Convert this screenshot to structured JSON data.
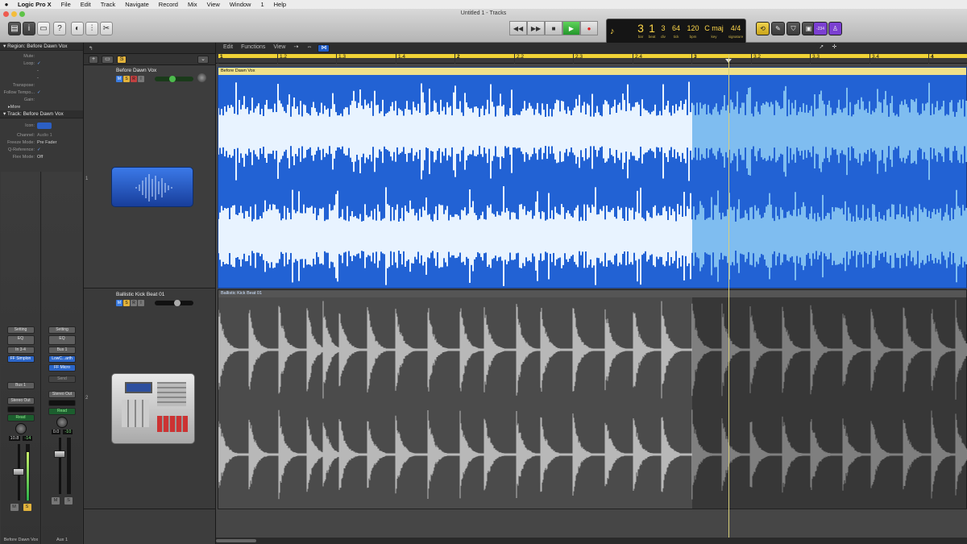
{
  "menubar": {
    "apple": "",
    "app": "Logic Pro X",
    "items": [
      "File",
      "Edit",
      "Track",
      "Navigate",
      "Record",
      "Mix",
      "View",
      "Window",
      "1",
      "Help"
    ]
  },
  "window": {
    "title": "Untitled 1 - Tracks"
  },
  "transport": {
    "buttons": [
      "rewind",
      "fast-forward",
      "stop",
      "play",
      "record"
    ]
  },
  "lcd": {
    "bar": "3",
    "beat": "1",
    "div": "3",
    "tick": "64",
    "bpm": "120",
    "key": "C maj",
    "signature": "4/4",
    "labels": {
      "bar": "bar",
      "beat": "beat",
      "div": "div",
      "tick": "tick",
      "bpm": "bpm",
      "key": "key",
      "signature": "signature"
    }
  },
  "count_in": "-234",
  "inspector": {
    "region_header": "Region: Before Dawn Vox",
    "region_rows": [
      {
        "k": "Mute:",
        "v": ""
      },
      {
        "k": "Loop:",
        "v": "✓"
      },
      {
        "k": "",
        "v": "-"
      },
      {
        "k": "",
        "v": "-"
      },
      {
        "k": "Transpose:",
        "v": ""
      },
      {
        "k": "Follow Tempo...",
        "v": "✓"
      },
      {
        "k": "Gain:",
        "v": ""
      }
    ],
    "more": "More",
    "track_header": "Track: Before Dawn Vox",
    "track_rows": [
      {
        "k": "Icon:",
        "v": ""
      },
      {
        "k": "Channel:",
        "v": "Audio 1"
      },
      {
        "k": "Freeze Mode:",
        "v": "Pre Fader"
      },
      {
        "k": "Q-Reference:",
        "v": "✓"
      },
      {
        "k": "Flex Mode:",
        "v": "Off"
      }
    ]
  },
  "strips": [
    {
      "setting": "Setting",
      "eq": "EQ",
      "input": "In 3-4",
      "plugin": "FF Simplon",
      "send": "Bus 1",
      "output": "Stereo Out",
      "auto": "Read",
      "vol": "10.8",
      "peak": "-14",
      "name": "Before Dawn Vox",
      "mute": "M",
      "solo": "S",
      "ir": "I R"
    },
    {
      "setting": "Setting",
      "eq": "EQ",
      "input": "Bus 1",
      "plugin": "LowC...arth",
      "plugin2": "FF Micro",
      "send": "Send",
      "output": "Stereo Out",
      "auto": "Read",
      "vol": "0.0",
      "peak": "-10",
      "name": "Aux 1",
      "mute": "M",
      "solo": "S"
    }
  ],
  "arrange_toolbar": {
    "edit": "Edit",
    "functions": "Functions",
    "view": "View"
  },
  "tracks": [
    {
      "num": "1",
      "name": "Before Dawn Vox",
      "m": "M",
      "s": "S",
      "r": "R",
      "i": "I"
    },
    {
      "num": "2",
      "name": "Ballistic Kick Beat 01",
      "m": "M",
      "s": "S",
      "r": "R",
      "i": "I"
    }
  ],
  "ruler": [
    "1",
    "1.2",
    "1.3",
    "1.4",
    "2",
    "2.2",
    "2.3",
    "2.4",
    "3",
    "3.2",
    "3.3",
    "3.4",
    "4"
  ],
  "regions": [
    {
      "name": "Before Dawn Vox"
    },
    {
      "name": "Ballistic Kick Beat 01"
    }
  ],
  "colors": {
    "audio_region": "#2262d4",
    "drum_region": "#4b4b4b",
    "cycle": "#f0d236",
    "play": "#2bb14a"
  }
}
